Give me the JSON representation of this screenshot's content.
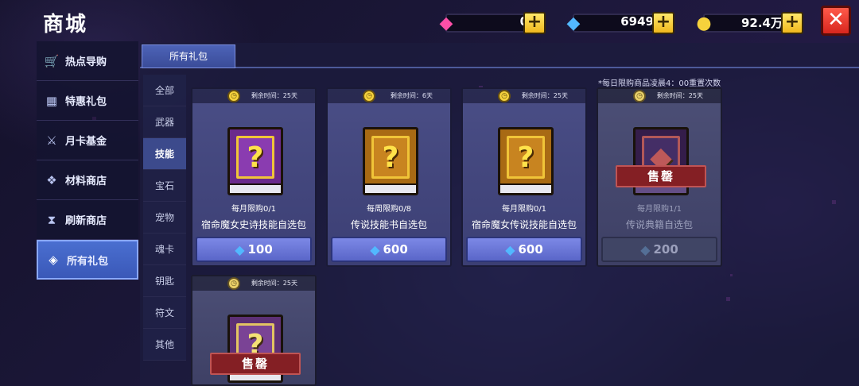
{
  "header": {
    "title": "商城",
    "resources": [
      {
        "icon": "pink-gem-icon",
        "value": "0"
      },
      {
        "icon": "blue-gem-icon",
        "value": "6949"
      },
      {
        "icon": "gold-coin-icon",
        "value": "92.4万"
      }
    ]
  },
  "sidebar": {
    "items": [
      {
        "label": "热点导购",
        "icon": "cart-icon"
      },
      {
        "label": "特惠礼包",
        "icon": "gift-icon"
      },
      {
        "label": "月卡基金",
        "icon": "fund-icon"
      },
      {
        "label": "材料商店",
        "icon": "gem-cluster-icon"
      },
      {
        "label": "刷新商店",
        "icon": "hourglass-icon"
      },
      {
        "label": "所有礼包",
        "icon": "diamond-outline-icon",
        "active": true
      }
    ]
  },
  "tabs": [
    {
      "label": "所有礼包"
    }
  ],
  "subnav": [
    "全部",
    "武器",
    "技能",
    "宝石",
    "宠物",
    "魂卡",
    "钥匙",
    "符文",
    "其他"
  ],
  "subnav_active": "技能",
  "note": "*每日限购商品凌晨4：00重置次数",
  "cards": [
    {
      "timer": "剩余时间：25天",
      "limit": "每月限购0/1",
      "name": "宿命魔女史诗技能自选包",
      "price": "100",
      "book": "purple",
      "sold": false
    },
    {
      "timer": "剩余时间：6天",
      "limit": "每周限购0/8",
      "name": "传说技能书自选包",
      "price": "600",
      "book": "gold",
      "sold": false
    },
    {
      "timer": "剩余时间：25天",
      "limit": "每月限购0/1",
      "name": "宿命魔女传说技能自选包",
      "price": "600",
      "book": "gold",
      "sold": false
    },
    {
      "timer": "剩余时间：25天",
      "limit": "每月限购1/1",
      "name": "传说典籍自选包",
      "price": "200",
      "book": "dark",
      "sold": true,
      "stamp": "售罄"
    },
    {
      "timer": "剩余时间：25天",
      "book": "purple",
      "sold": true,
      "stamp": "售罄"
    }
  ],
  "colors": {
    "accent": "#4a6fd0",
    "close": "#d8261e",
    "gem": "#52b8ff",
    "coin": "#f6d23c"
  }
}
